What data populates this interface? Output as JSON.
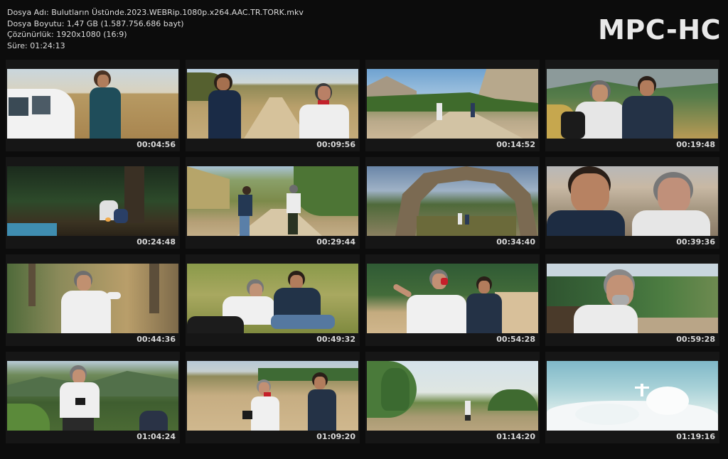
{
  "info": {
    "file_name": "Dosya Adı: Bulutların Üstünde.2023.WEBRip.1080p.x264.AAC.TR.TORK.mkv",
    "file_size": "Dosya Boyutu: 1,47 GB (1.587.756.686 bayt)",
    "resolution": "Çözünürlük: 1920x1080 (16:9)",
    "duration": "Süre: 01:24:13"
  },
  "brand": "MPC-HC",
  "thumbnails": [
    {
      "time": "00:04:56",
      "scene": "man-beside-white-car"
    },
    {
      "time": "00:09:56",
      "scene": "two-men-on-dirt-road"
    },
    {
      "time": "00:14:52",
      "scene": "hikers-in-canyon"
    },
    {
      "time": "00:19:48",
      "scene": "two-men-forest"
    },
    {
      "time": "00:24:48",
      "scene": "dark-forest-campfire"
    },
    {
      "time": "00:29:44",
      "scene": "two-men-walking-path"
    },
    {
      "time": "00:34:40",
      "scene": "stone-arch-ruins"
    },
    {
      "time": "00:39:36",
      "scene": "two-men-closeup"
    },
    {
      "time": "00:44:36",
      "scene": "man-in-forest"
    },
    {
      "time": "00:49:32",
      "scene": "two-men-sitting-grass"
    },
    {
      "time": "00:54:28",
      "scene": "two-men-gesturing"
    },
    {
      "time": "00:59:28",
      "scene": "bearded-man-smiling"
    },
    {
      "time": "01:04:24",
      "scene": "man-with-camera-hills"
    },
    {
      "time": "01:09:20",
      "scene": "two-men-open-field"
    },
    {
      "time": "01:14:20",
      "scene": "figure-among-trees"
    },
    {
      "time": "01:19:16",
      "scene": "figure-on-clouds"
    }
  ]
}
